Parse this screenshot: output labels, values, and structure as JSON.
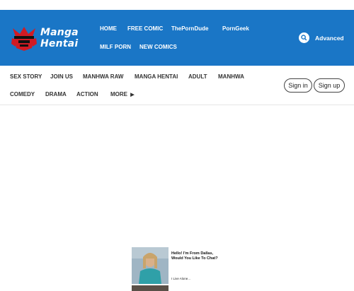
{
  "header": {
    "logo_line1": "Manga",
    "logo_line2": "Hentai",
    "nav": [
      "HOME",
      "FREE COMIC",
      "ThePornDude",
      "PornGeek",
      "MILF PORN",
      "NEW COMICS"
    ],
    "advanced_label": "Advanced"
  },
  "subnav": {
    "items": [
      "SEX STORY",
      "JOIN US",
      "MANHWA RAW",
      "MANGA HENTAI",
      "ADULT",
      "MANHWA",
      "COMEDY",
      "DRAMA",
      "ACTION",
      "MORE"
    ],
    "sign_in": "Sign in",
    "sign_up": "Sign up"
  },
  "ad": {
    "title": "Hello! I'm From Dallas, Would You Like To Chat?",
    "subtitle": "I Live Alone..."
  },
  "colors": {
    "header_bg": "#1a76c6",
    "logo_red": "#d11b24"
  }
}
